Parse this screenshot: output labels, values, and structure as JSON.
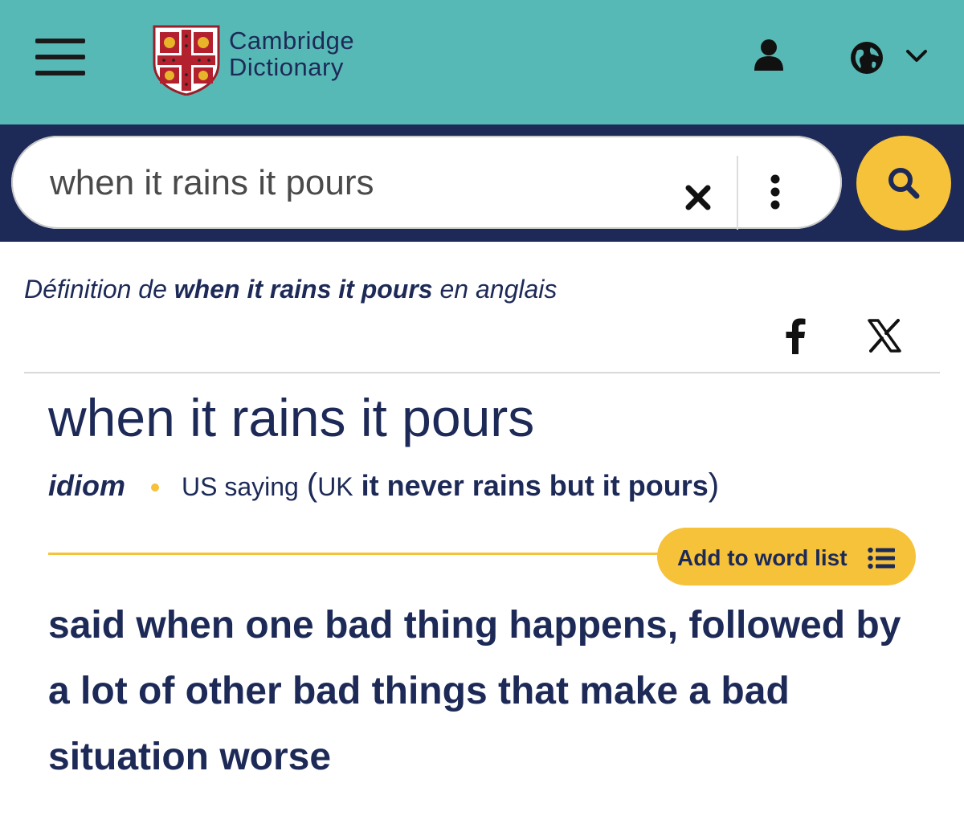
{
  "header": {
    "logo_line1": "Cambridge",
    "logo_line2": "Dictionary",
    "background": "#57b9b6"
  },
  "search": {
    "value": "when it rains it pours",
    "band_color": "#1d2a57",
    "button_color": "#f6c23a"
  },
  "breadcrumb": {
    "prefix": "Définition de ",
    "term": "when it rains it pours",
    "suffix": " en anglais"
  },
  "share": {
    "facebook_icon": "facebook-icon",
    "x_icon": "x-icon"
  },
  "entry": {
    "headword": "when it rains it pours",
    "pos": "idiom",
    "usage": "US saying",
    "paren_open": "(",
    "variant_region": "UK",
    "variant": "it never rains but it pours",
    "paren_close": ")",
    "add_to_list_label": "Add to word list",
    "definition": "said when one bad thing happens, followed by a lot of other bad things that make a bad situation worse"
  },
  "colors": {
    "text": "#1d2a57",
    "accent": "#f6c23a"
  }
}
